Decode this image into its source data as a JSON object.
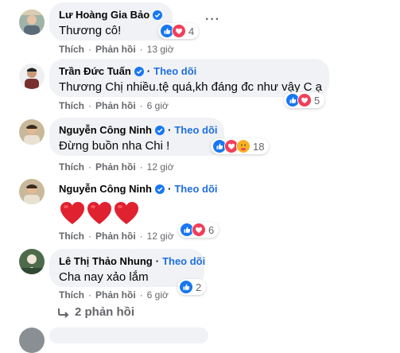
{
  "comments": [
    {
      "name": "Lư Hoàng Gia Bảo",
      "verified": true,
      "follow": "",
      "text": "Thương cô!",
      "like": "Thích",
      "reply": "Phản hồi",
      "time": "13 giờ",
      "reaction_count": "4",
      "reactions": [
        "like-icon",
        "love-icon"
      ]
    },
    {
      "name": "Trần Đức Tuấn",
      "verified": true,
      "follow": "Theo dõi",
      "text": "Thương Chị nhiều.tệ quá,kh đáng đc như vậy C ạ",
      "like": "Thích",
      "reply": "Phản hồi",
      "time": "6 giờ",
      "reaction_count": "5",
      "reactions": [
        "like-icon",
        "love-icon"
      ]
    },
    {
      "name": "Nguyễn Công Ninh",
      "verified": true,
      "follow": "Theo dõi",
      "text": "Đừng buồn nha Chi !",
      "like": "Thích",
      "reply": "Phản hồi",
      "time": "12 giờ",
      "reaction_count": "18",
      "reactions": [
        "like-icon",
        "love-icon",
        "care-icon"
      ]
    },
    {
      "name": "Nguyễn Công Ninh",
      "verified": true,
      "follow": "Theo dõi",
      "text": "",
      "hearts": 3,
      "like": "Thích",
      "reply": "Phản hồi",
      "time": "12 giờ",
      "reaction_count": "6",
      "reactions": [
        "like-icon",
        "love-icon"
      ]
    },
    {
      "name": "Lê Thị Thảo Nhung",
      "verified": false,
      "follow": "Theo dõi",
      "text": "Cha nay xảo lắm",
      "like": "Thích",
      "reply": "Phản hồi",
      "time": "6 giờ",
      "reaction_count": "2",
      "reactions": [
        "like-icon"
      ]
    }
  ],
  "replies_link": "2 phản hồi",
  "separator": "·",
  "colors": {
    "bubble": "#f0f2f5",
    "follow": "#216fdb",
    "meta": "#65676b",
    "like": "#1877f2",
    "love": "#f33e58"
  }
}
